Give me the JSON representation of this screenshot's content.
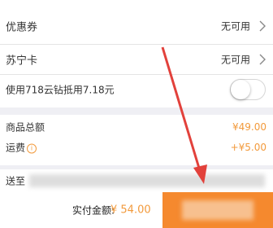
{
  "coupon": {
    "label": "优惠券",
    "value": "无可用"
  },
  "suning_card": {
    "label": "苏宁卡",
    "value": "无可用"
  },
  "diamond": {
    "label": "使用718云钻抵用7.18元",
    "enabled": false
  },
  "totals": {
    "goods_label": "商品总额",
    "goods_amount": "¥49.00",
    "shipping_label": "运费",
    "shipping_amount": "+¥5.00"
  },
  "delivery": {
    "prefix": "送至"
  },
  "footer": {
    "pay_label": "实付金额:",
    "pay_amount": "¥ 54.00"
  },
  "colors": {
    "accent": "#f29a3c",
    "submit": "#f5892e",
    "arrow": "#e2413b"
  },
  "icons": {
    "chevron": "chevron-right-icon",
    "info": "info-icon",
    "arrow": "annotation-arrow"
  }
}
